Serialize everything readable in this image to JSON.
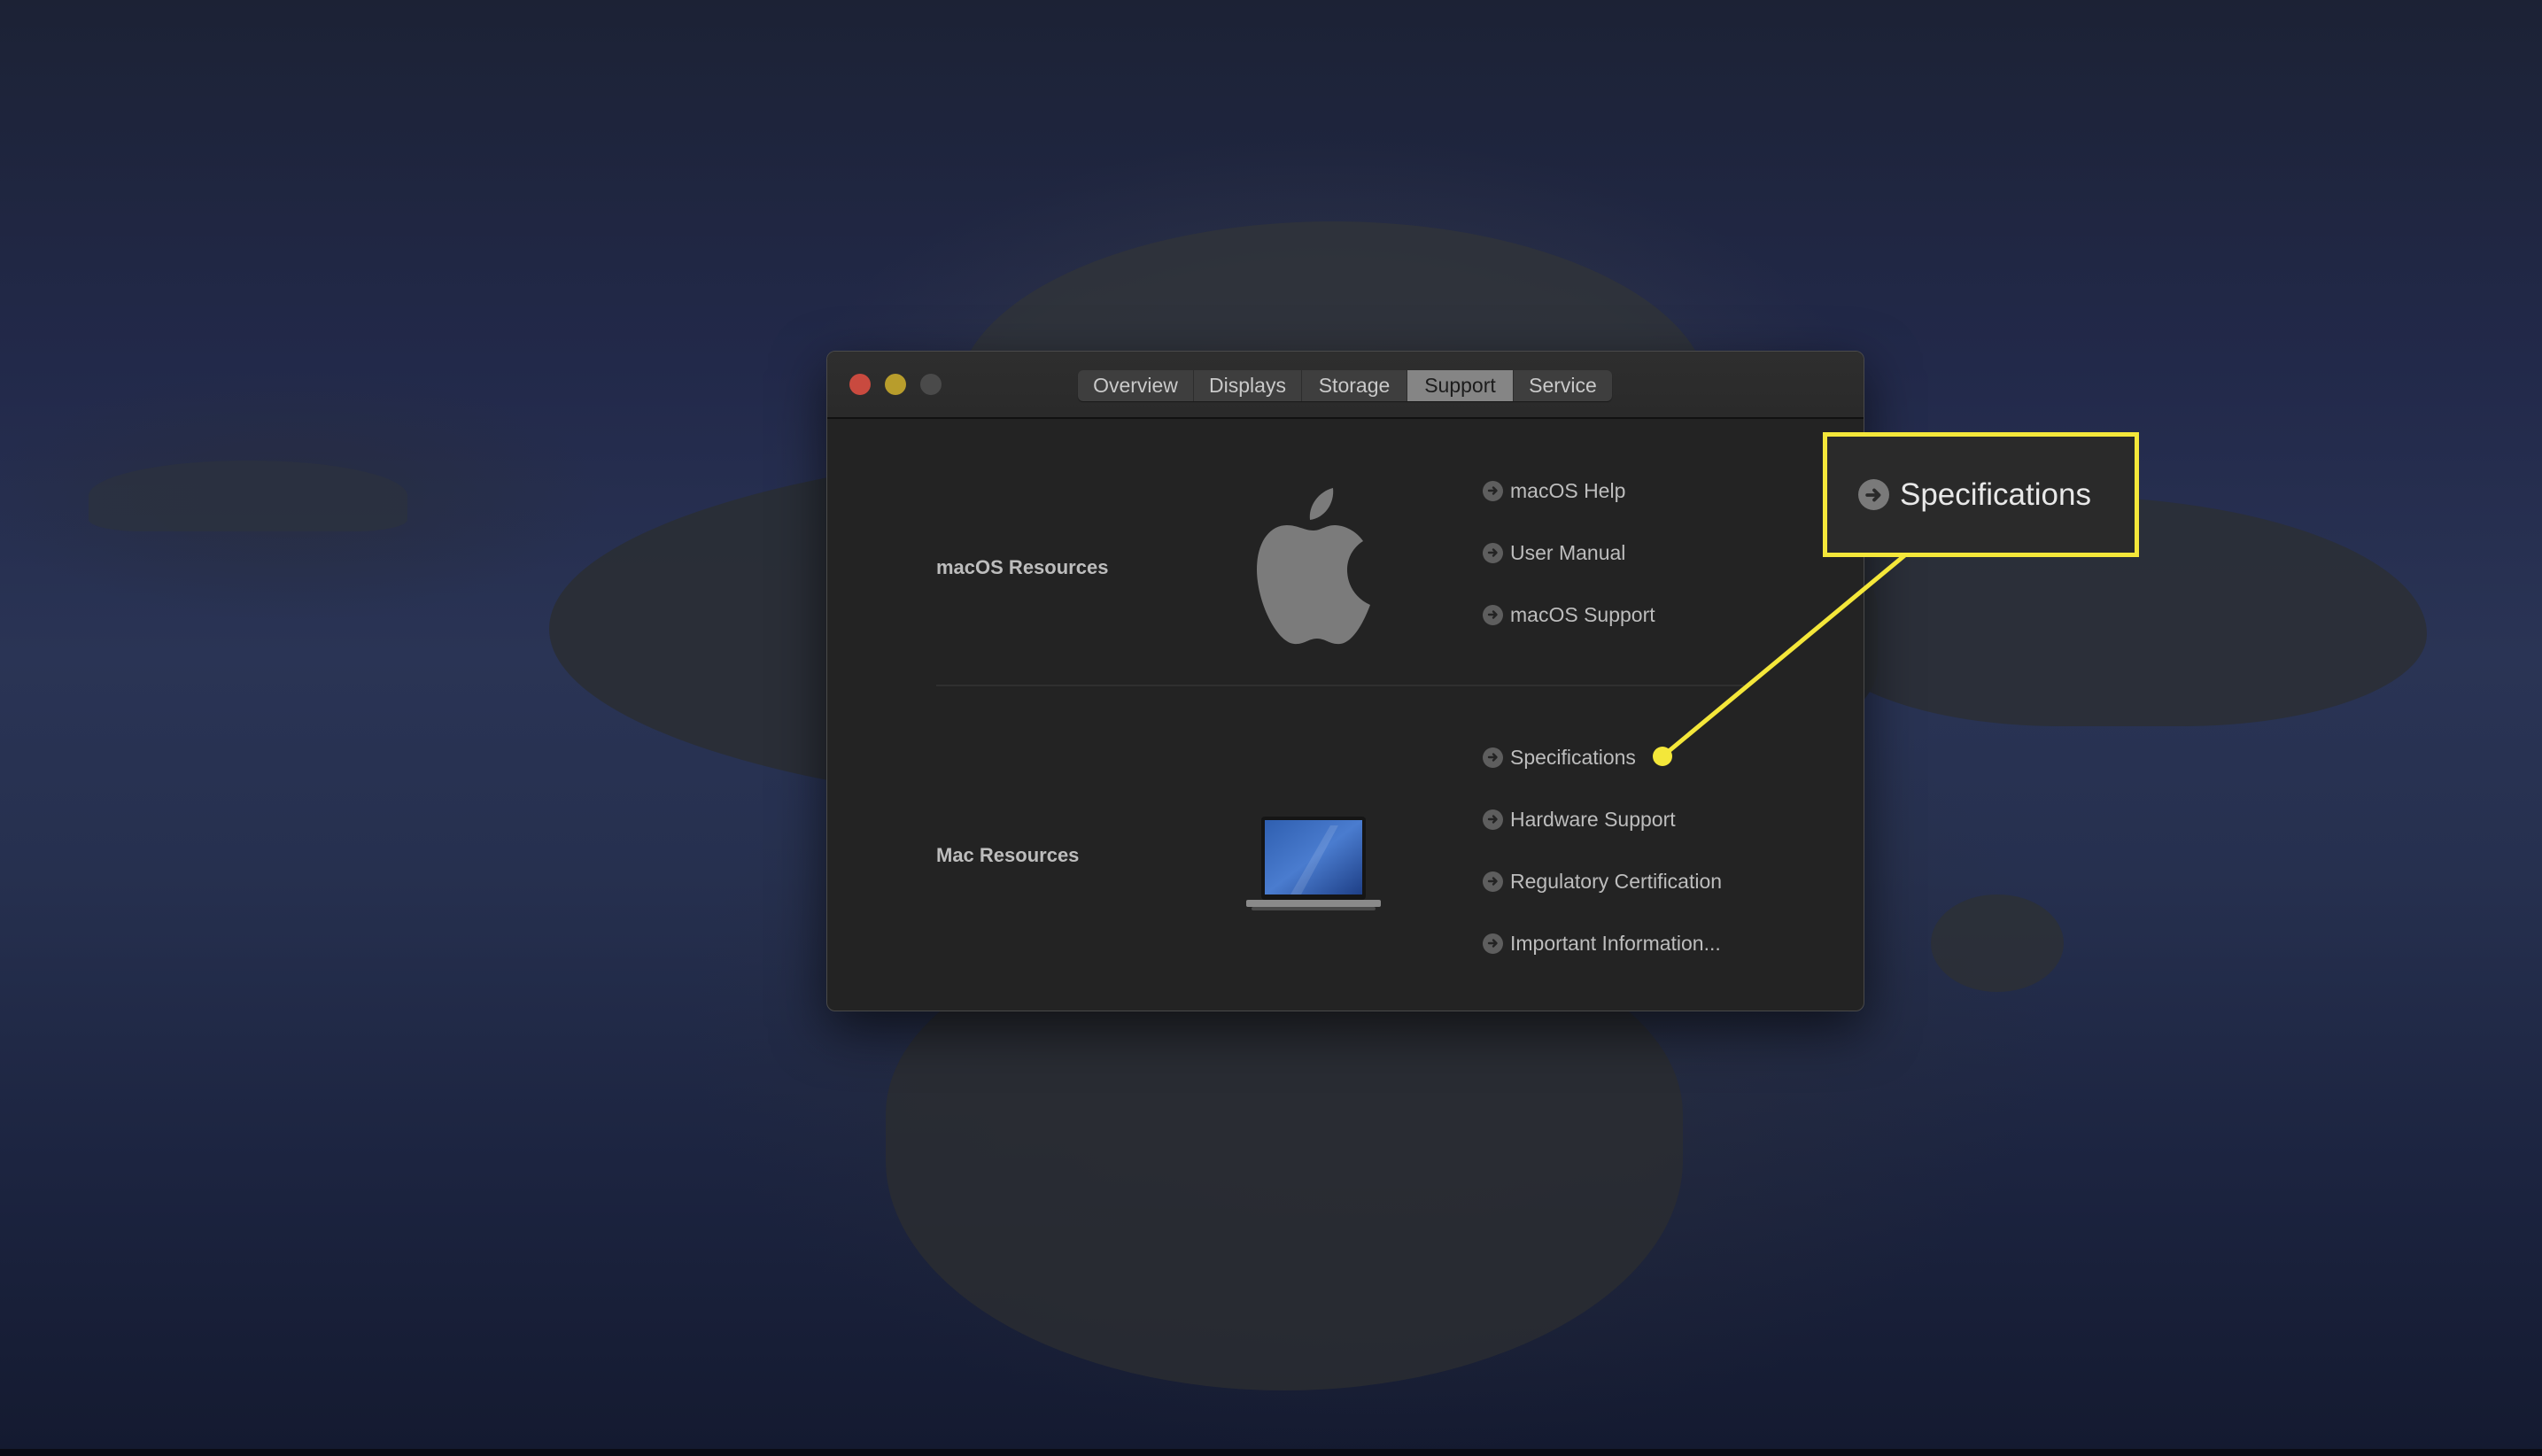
{
  "window": {
    "traffic_lights": [
      "close",
      "minimize",
      "zoom"
    ],
    "tabs": [
      {
        "label": "Overview",
        "active": false
      },
      {
        "label": "Displays",
        "active": false
      },
      {
        "label": "Storage",
        "active": false
      },
      {
        "label": "Support",
        "active": true
      },
      {
        "label": "Service",
        "active": false
      }
    ],
    "sections": [
      {
        "title": "macOS Resources",
        "icon": "apple-logo-icon",
        "links": [
          "macOS Help",
          "User Manual",
          "macOS Support"
        ]
      },
      {
        "title": "Mac Resources",
        "icon": "macbook-icon",
        "links": [
          "Specifications",
          "Hardware Support",
          "Regulatory Certification",
          "Important Information..."
        ]
      }
    ]
  },
  "callout": {
    "label": "Specifications",
    "icon": "arrow-circle-icon",
    "color": "#f4e73a",
    "points_to": "Specifications"
  },
  "colors": {
    "window_bg": "#232323",
    "titlebar_bg": "#2e2e2e",
    "tab_active_bg": "#858585",
    "close": "#c94a3f",
    "minimize": "#b89d2c",
    "zoom": "#4a4a4a"
  }
}
